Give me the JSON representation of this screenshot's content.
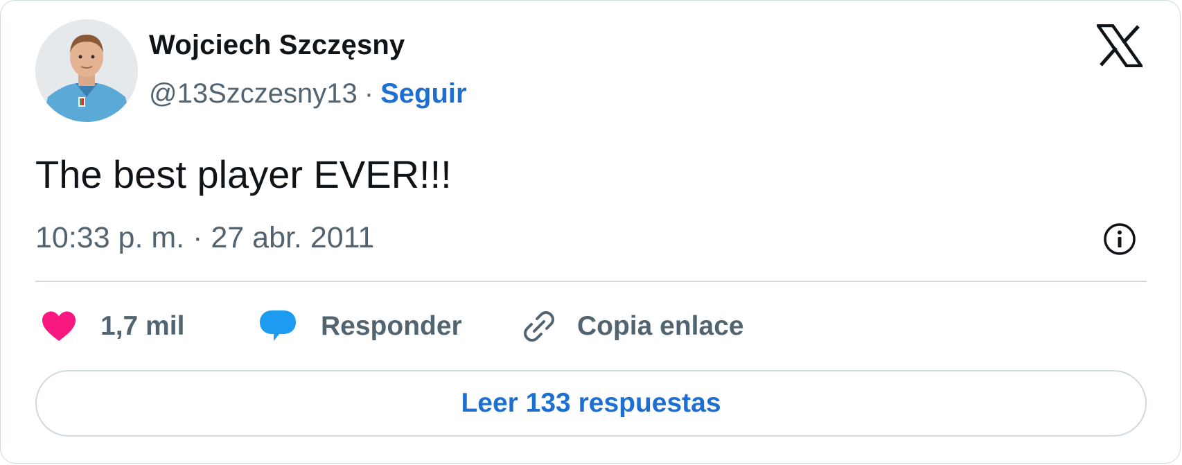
{
  "author": {
    "name": "Wojciech Szczęsny",
    "handle": "@13Szczesny13",
    "separator": "·",
    "follow_label": "Seguir"
  },
  "tweet": {
    "text": "The best player EVER!!!",
    "time": "10:33 p. m.",
    "meta_separator": "·",
    "date": "27 abr. 2011"
  },
  "actions": {
    "like_count": "1,7 mil",
    "reply_label": "Responder",
    "copy_label": "Copia enlace"
  },
  "read_replies_label": "Leer 133 respuestas",
  "icons": {
    "brand": "x-logo-icon",
    "info": "info-icon",
    "like": "heart-icon",
    "reply": "speech-bubble-icon",
    "copy": "link-icon"
  },
  "colors": {
    "like": "#f91880",
    "reply": "#1d9bf0",
    "link": "#1d6fd1",
    "text": "#0f1419",
    "muted": "#536471",
    "border": "#cfd9de"
  }
}
